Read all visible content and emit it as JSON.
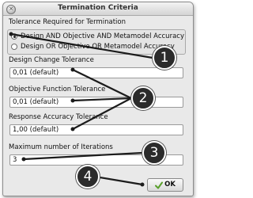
{
  "dialog": {
    "title": "Termination Criteria",
    "close_glyph": "×"
  },
  "tolerance_group": {
    "label": "Tolerance Required for Termination",
    "options": [
      {
        "label": "Design AND Objective AND Metamodel Accuracy",
        "selected": true
      },
      {
        "label": "Design OR Objective OR Metamodel Accuracy",
        "selected": false
      }
    ]
  },
  "design_change": {
    "label": "Design Change Tolerance",
    "value": "0,01 (default)"
  },
  "objective_function": {
    "label": "Objective Function Tolerance",
    "value": "0,01 (default)"
  },
  "response_accuracy": {
    "label": "Response Accuracy Tolerance",
    "value": "1,00 (default)"
  },
  "max_iterations": {
    "label": "Maximum number of Iterations",
    "value": "3"
  },
  "ok_button": {
    "label": "OK",
    "icon": "check-icon",
    "icon_color": "#5aa02c"
  },
  "callouts": [
    {
      "number": "1"
    },
    {
      "number": "2"
    },
    {
      "number": "3"
    },
    {
      "number": "4"
    }
  ],
  "colors": {
    "callout": "#2b2b2b",
    "dialog_bg": "#e9e9e9"
  }
}
